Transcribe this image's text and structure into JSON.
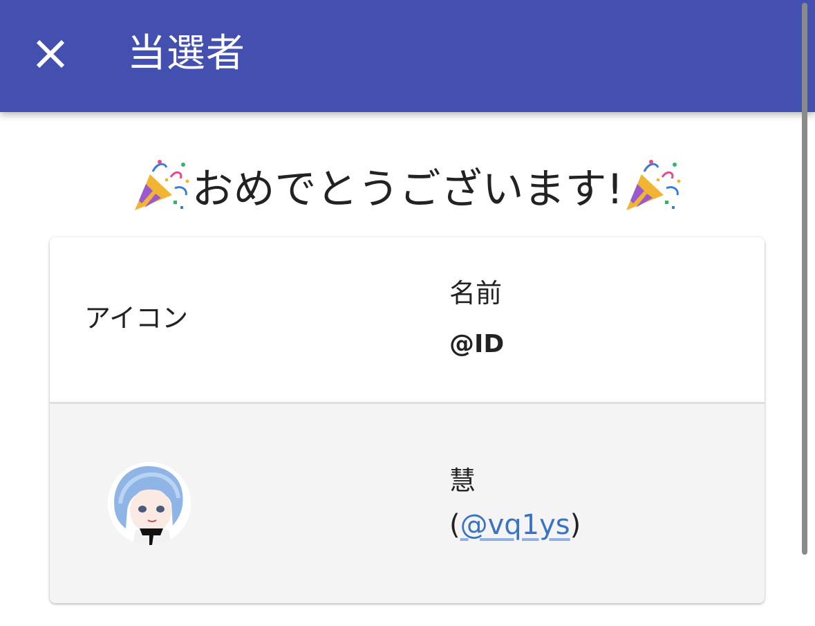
{
  "app_bar": {
    "title": "当選者",
    "close_icon": "close-icon",
    "background_color": "#4350b0"
  },
  "congrats": {
    "text": "おめでとうございます!",
    "emoji_icon": "party-popper-icon"
  },
  "table": {
    "headers": {
      "icon": "アイコン",
      "name": "名前",
      "id": "@ID"
    },
    "rows": [
      {
        "avatar_icon": "user-avatar",
        "name": "慧",
        "id_open": "(",
        "id_link": "@vq1ys",
        "id_close": ")"
      }
    ]
  },
  "colors": {
    "link": "#3a73c4",
    "row_background": "#f4f4f4"
  }
}
